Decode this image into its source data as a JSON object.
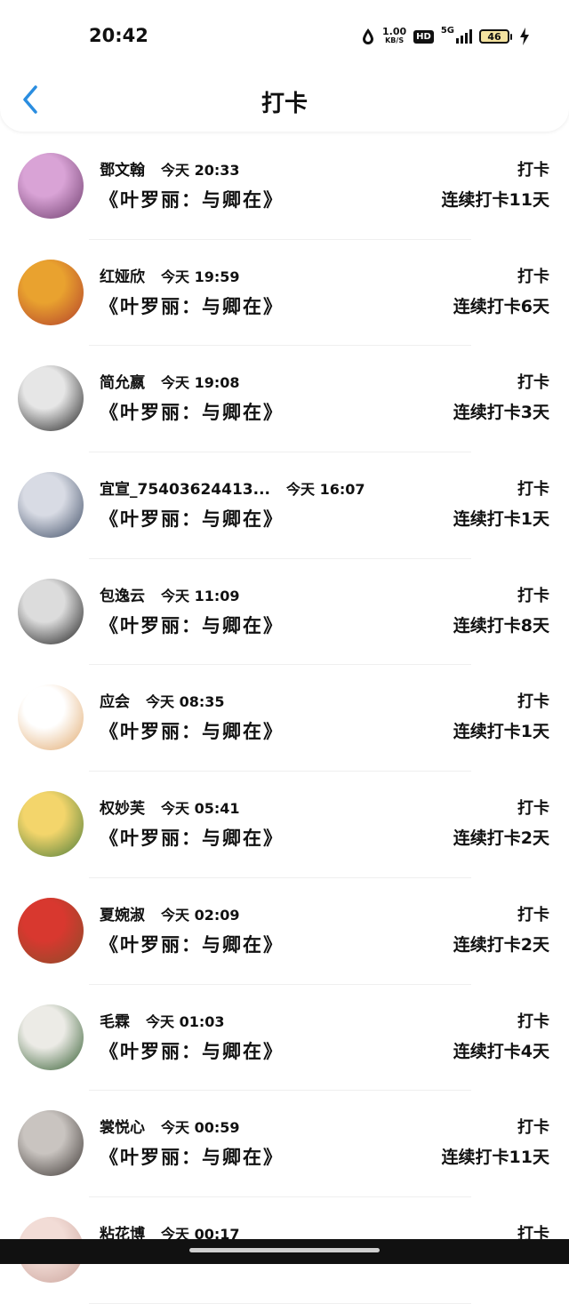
{
  "status_bar": {
    "time": "20:42",
    "net_speed": "1.00",
    "net_unit": "KB/S",
    "hd": "HD",
    "network": "5G",
    "battery": "46"
  },
  "header": {
    "title": "打卡"
  },
  "entries": [
    {
      "name": "鄧文翰",
      "time": "今天 20:33",
      "book": "《叶罗丽：与卿在》",
      "action": "打卡",
      "streak": "连续打卡11天",
      "avatar_colors": [
        "#d9a3d6",
        "#6b3b6a"
      ]
    },
    {
      "name": "红娅欣",
      "time": "今天 19:59",
      "book": "《叶罗丽：与卿在》",
      "action": "打卡",
      "streak": "连续打卡6天",
      "avatar_colors": [
        "#e9a22f",
        "#b13d2b"
      ]
    },
    {
      "name": "简允嬴",
      "time": "今天 19:08",
      "book": "《叶罗丽：与卿在》",
      "action": "打卡",
      "streak": "连续打卡3天",
      "avatar_colors": [
        "#e6e6e6",
        "#1d1d1d"
      ]
    },
    {
      "name": "宜宣_75403624413...",
      "time": "今天 16:07",
      "book": "《叶罗丽：与卿在》",
      "action": "打卡",
      "streak": "连续打卡1天",
      "avatar_colors": [
        "#d8dbe4",
        "#3b4a63"
      ]
    },
    {
      "name": "包逸云",
      "time": "今天 11:09",
      "book": "《叶罗丽：与卿在》",
      "action": "打卡",
      "streak": "连续打卡8天",
      "avatar_colors": [
        "#dcdcdc",
        "#1a1a1a"
      ]
    },
    {
      "name": "应会",
      "time": "今天 08:35",
      "book": "《叶罗丽：与卿在》",
      "action": "打卡",
      "streak": "连续打卡1天",
      "avatar_colors": [
        "#ffffff",
        "#e1a86b"
      ]
    },
    {
      "name": "权妙芙",
      "time": "今天 05:41",
      "book": "《叶罗丽：与卿在》",
      "action": "打卡",
      "streak": "连续打卡2天",
      "avatar_colors": [
        "#f3d56b",
        "#4a7b3a"
      ]
    },
    {
      "name": "夏婉淑",
      "time": "今天 02:09",
      "book": "《叶罗丽：与卿在》",
      "action": "打卡",
      "streak": "连续打卡2天",
      "avatar_colors": [
        "#d8382f",
        "#8a4d2a"
      ]
    },
    {
      "name": "毛霖",
      "time": "今天 01:03",
      "book": "《叶罗丽：与卿在》",
      "action": "打卡",
      "streak": "连续打卡4天",
      "avatar_colors": [
        "#ecebe6",
        "#2f5a2c"
      ]
    },
    {
      "name": "裳悦心",
      "time": "今天 00:59",
      "book": "《叶罗丽：与卿在》",
      "action": "打卡",
      "streak": "连续打卡11天",
      "avatar_colors": [
        "#c9c4c0",
        "#3b3532"
      ]
    },
    {
      "name": "粘花博",
      "time": "今天 00:17",
      "book": "",
      "action": "打卡",
      "streak": "",
      "avatar_colors": [
        "#f2dcd6",
        "#caa39b"
      ]
    }
  ]
}
